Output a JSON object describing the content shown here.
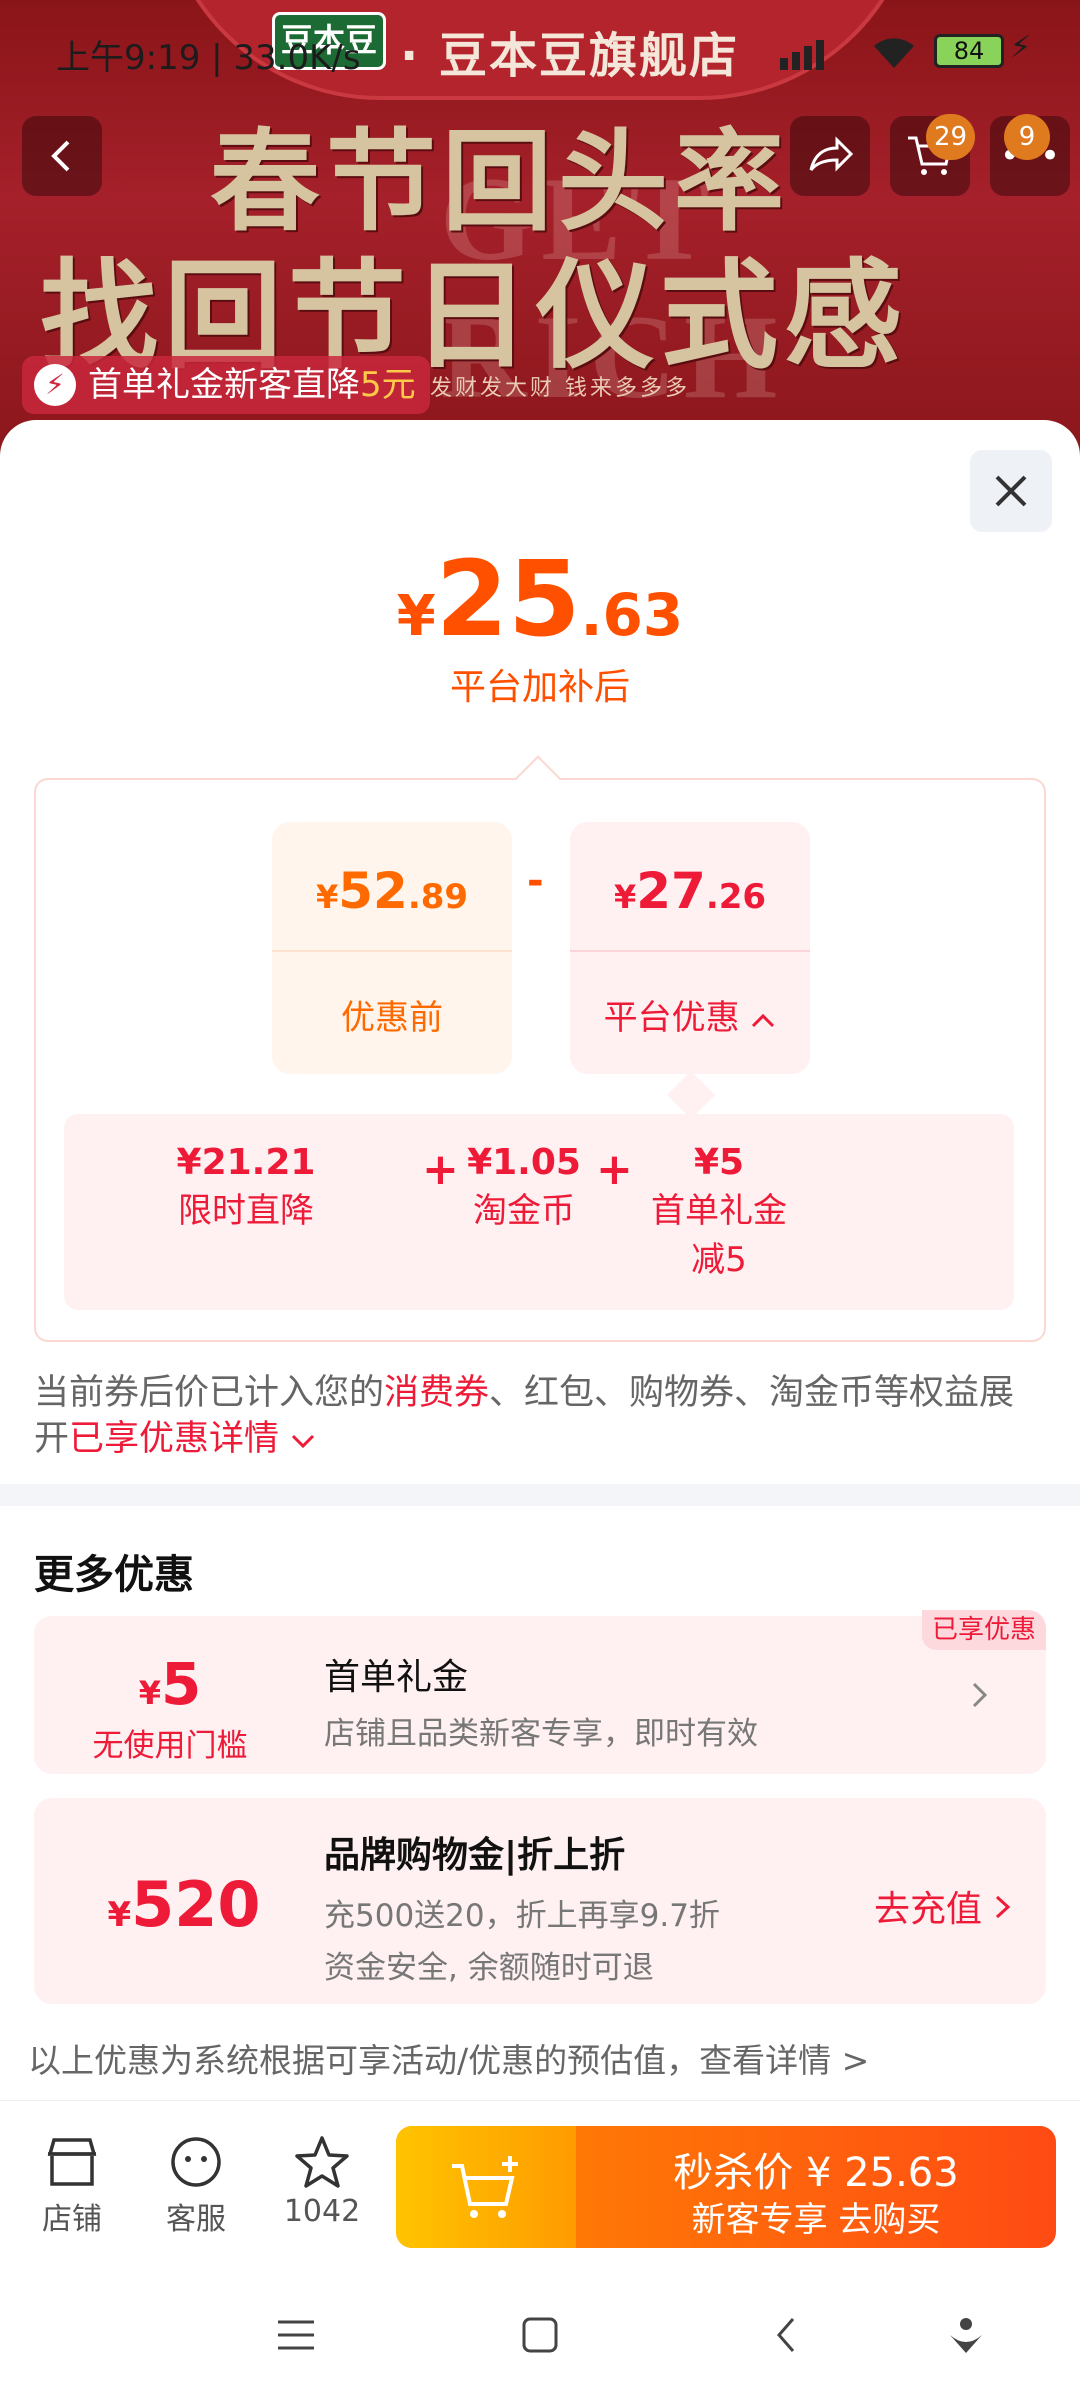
{
  "status": {
    "time": "上午9:19 | 33.0K/s",
    "battery": "84"
  },
  "banner": {
    "brand_logo": "豆本豆",
    "shop_title": "· 豆本豆旗舰店",
    "headline1": "春节回头率",
    "headline2": "找回节日仪式感",
    "ghost_text": "GET RICH",
    "cart_badge": "29",
    "more_badge": "9",
    "promo_prefix": "首单礼金新客直降",
    "promo_amount": "5元",
    "promo_sub": "发财发大财 钱来多多多"
  },
  "sheet": {
    "price_currency": "¥",
    "price_int": "25",
    "price_dec": ".63",
    "price_caption": "平台加补后",
    "before": {
      "currency": "¥",
      "int": "52",
      "dec": ".89",
      "label": "优惠前"
    },
    "minus": "-",
    "platform": {
      "currency": "¥",
      "int": "27",
      "dec": ".26",
      "label": "平台优惠"
    },
    "details": [
      {
        "value": "¥21.21",
        "label": "限时直降"
      },
      {
        "value": "¥1.05",
        "label": "淘金币"
      },
      {
        "value": "¥5",
        "label": "首单礼金",
        "label2": "减5"
      }
    ],
    "plus": "+",
    "note_pre": "当前券后价已计入您的",
    "note_hl": "消费券",
    "note_mid": "、红包、购物券、淘金币等权益展开",
    "note_link": "已享优惠详情",
    "more_title": "更多优惠",
    "offers": [
      {
        "currency": "¥",
        "amount": "5",
        "sub": "无使用门槛",
        "title": "首单礼金",
        "desc": "店铺且品类新客专享，即时有效",
        "tag": "已享优惠"
      },
      {
        "currency": "¥",
        "amount": "520",
        "title": "品牌购物金|折上折",
        "desc": "充500送20，折上再享9.7折",
        "desc2": "资金安全, 余额随时可退",
        "action": "去充值"
      }
    ],
    "footnote": "以上优惠为系统根据可享活动/优惠的预估值，查看详情 >"
  },
  "bottom": {
    "store": "店铺",
    "service": "客服",
    "fav_count": "1042",
    "buy_line1": "秒杀价 ¥ 25.63",
    "buy_line2": "新客专享  去购买"
  }
}
